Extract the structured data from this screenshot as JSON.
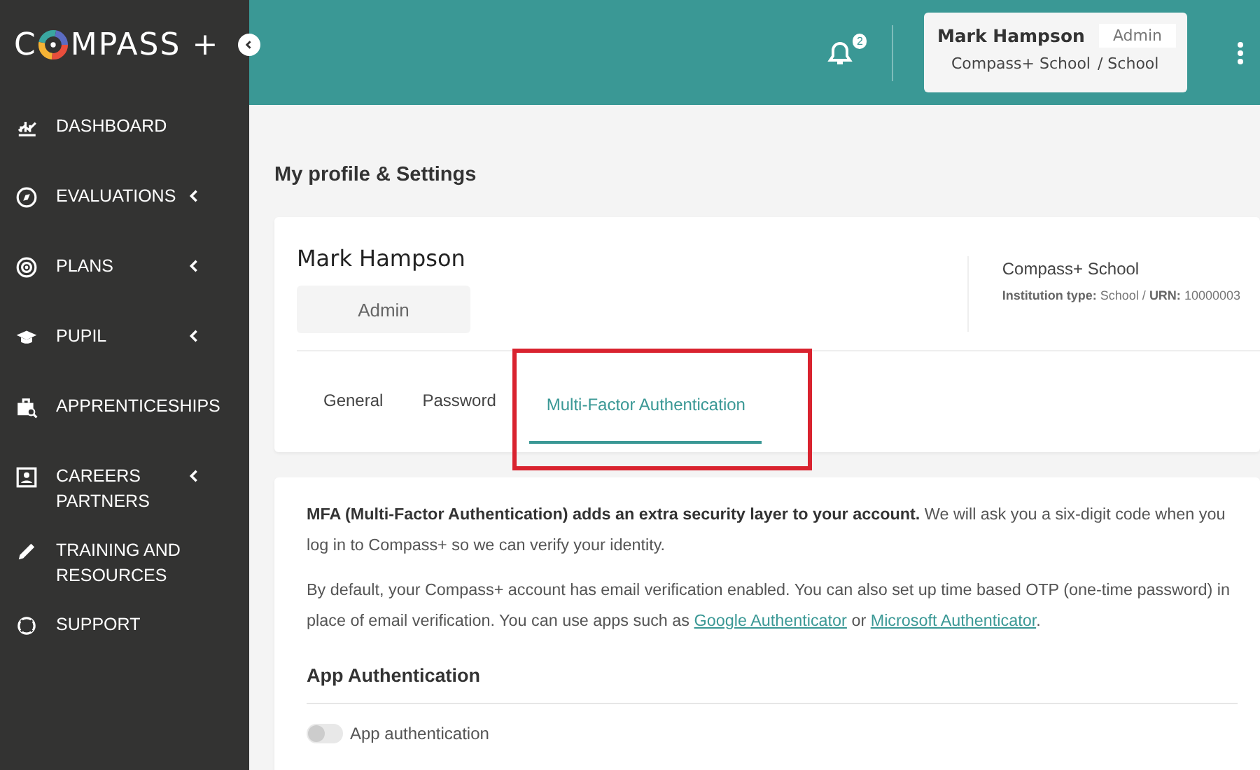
{
  "logo": {
    "before": "C",
    "after": "MPASS +"
  },
  "sidebar": {
    "items": [
      {
        "label": "DASHBOARD",
        "expandable": false
      },
      {
        "label": "EVALUATIONS",
        "expandable": true
      },
      {
        "label": "PLANS",
        "expandable": true
      },
      {
        "label": "PUPIL",
        "expandable": true
      },
      {
        "label": "APPRENTICESHIPS",
        "expandable": false
      },
      {
        "label": "CAREERS PARTNERS",
        "expandable": true
      },
      {
        "label": "TRAINING AND RESOURCES",
        "expandable": false
      },
      {
        "label": "SUPPORT",
        "expandable": false
      }
    ]
  },
  "header": {
    "notifications": "2",
    "user": {
      "name": "Mark Hampson",
      "role": "Admin",
      "school": "Compass+ School",
      "type": "/ School"
    }
  },
  "page_title": "My profile & Settings",
  "profile": {
    "name": "Mark Hampson",
    "role": "Admin",
    "institution": "Compass+ School",
    "details": [
      {
        "label": "Institution type:",
        "value": "School /"
      },
      {
        "label": "URN:",
        "value": "10000003"
      }
    ]
  },
  "tabs": [
    {
      "label": "General",
      "selected": false,
      "highlighted": false
    },
    {
      "label": "Password",
      "selected": false,
      "highlighted": false
    },
    {
      "label": "Multi-Factor Authentication",
      "selected": true,
      "highlighted": true
    }
  ],
  "mfa": {
    "intro": "**MFA (Multi-Factor Authentication) adds an extra security layer to your account.** We will ask you a six-digit code when you log in to Compass+ so we can verify your identity.",
    "paragraph": [
      {
        "kind": "text",
        "text": "By default, your Compass+ account has email verification enabled. You can also set up time based OTP (one-time password) in place of email verification. You can use apps such as "
      },
      {
        "kind": "link",
        "text": "Google Authenticator"
      },
      {
        "kind": "text",
        "text": " or "
      },
      {
        "kind": "link",
        "text": "Microsoft Authenticator"
      },
      {
        "kind": "text",
        "text": "."
      }
    ],
    "section_title": "App Authentication",
    "toggle": {
      "label": "App authentication",
      "on": false
    }
  }
}
